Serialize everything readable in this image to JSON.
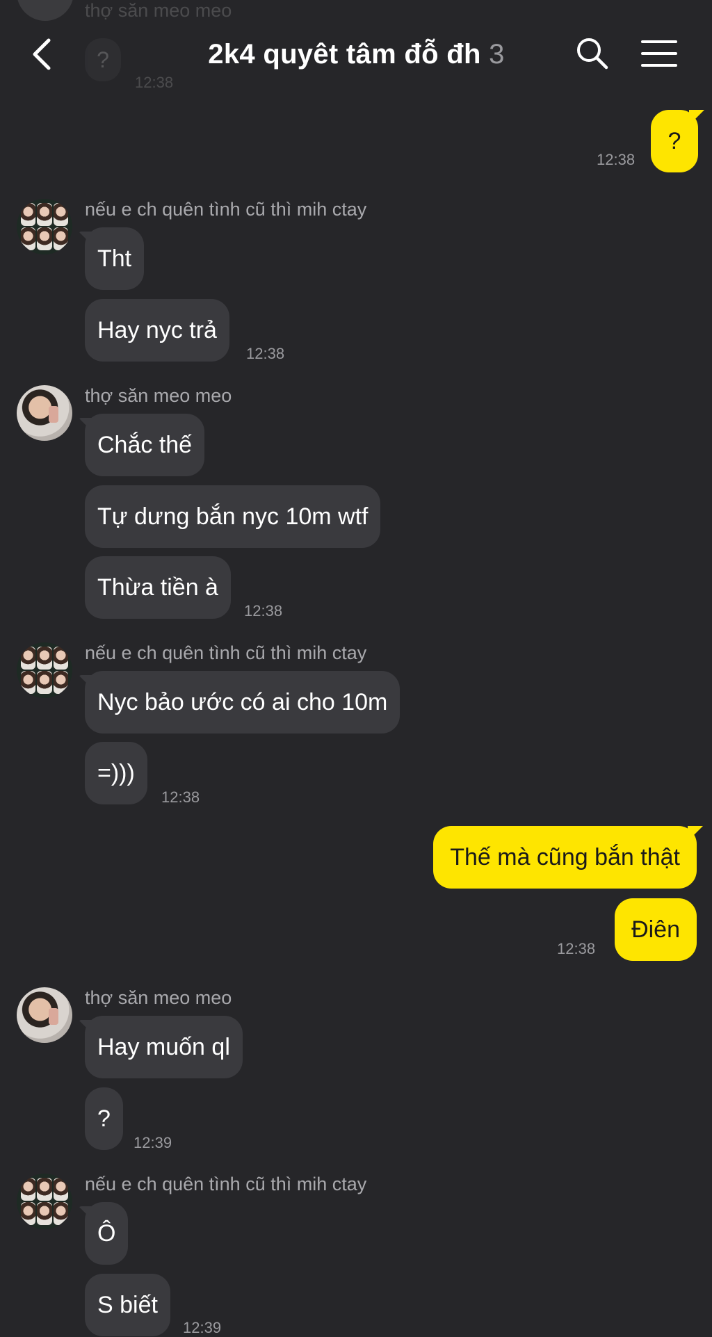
{
  "header": {
    "title": "2k4 quyêt tâm đỗ đh",
    "member_count": "3",
    "back_icon": "chevron-left-icon",
    "search_icon": "search-icon",
    "menu_icon": "hamburger-menu-icon"
  },
  "ghost": {
    "sender": "thợ săn meo meo",
    "text": "?",
    "time": "12:38"
  },
  "colors": {
    "background": "#262629",
    "incoming_bubble": "#3a3a3e",
    "outgoing_bubble": "#fee500",
    "muted_text": "#9a9a9e"
  },
  "messages": [
    {
      "text": "?",
      "time": "12:38"
    },
    {
      "sender": "nếu e ch quên tình cũ thì mih ctay"
    },
    {
      "text": "Tht"
    },
    {
      "text": "Hay nyc trả",
      "time": "12:38"
    },
    {
      "sender": "thợ săn meo meo"
    },
    {
      "text": "Chắc thế"
    },
    {
      "text": "Tự dưng bắn nyc 10m wtf"
    },
    {
      "text": "Thừa tiền à",
      "time": "12:38"
    },
    {
      "sender": "nếu e ch quên tình cũ thì mih ctay"
    },
    {
      "text": "Nyc bảo ước có ai cho 10m"
    },
    {
      "text": "=)))",
      "time": "12:38"
    },
    {
      "text": "Thế mà cũng bắn thật"
    },
    {
      "text": "Điên",
      "time": "12:38"
    },
    {
      "sender": "thợ săn meo meo"
    },
    {
      "text": "Hay muốn ql"
    },
    {
      "text": "?",
      "time": "12:39"
    },
    {
      "sender": "nếu e ch quên tình cũ thì mih ctay"
    },
    {
      "text": "Ô"
    },
    {
      "text": "S biết",
      "time": "12:39"
    }
  ]
}
